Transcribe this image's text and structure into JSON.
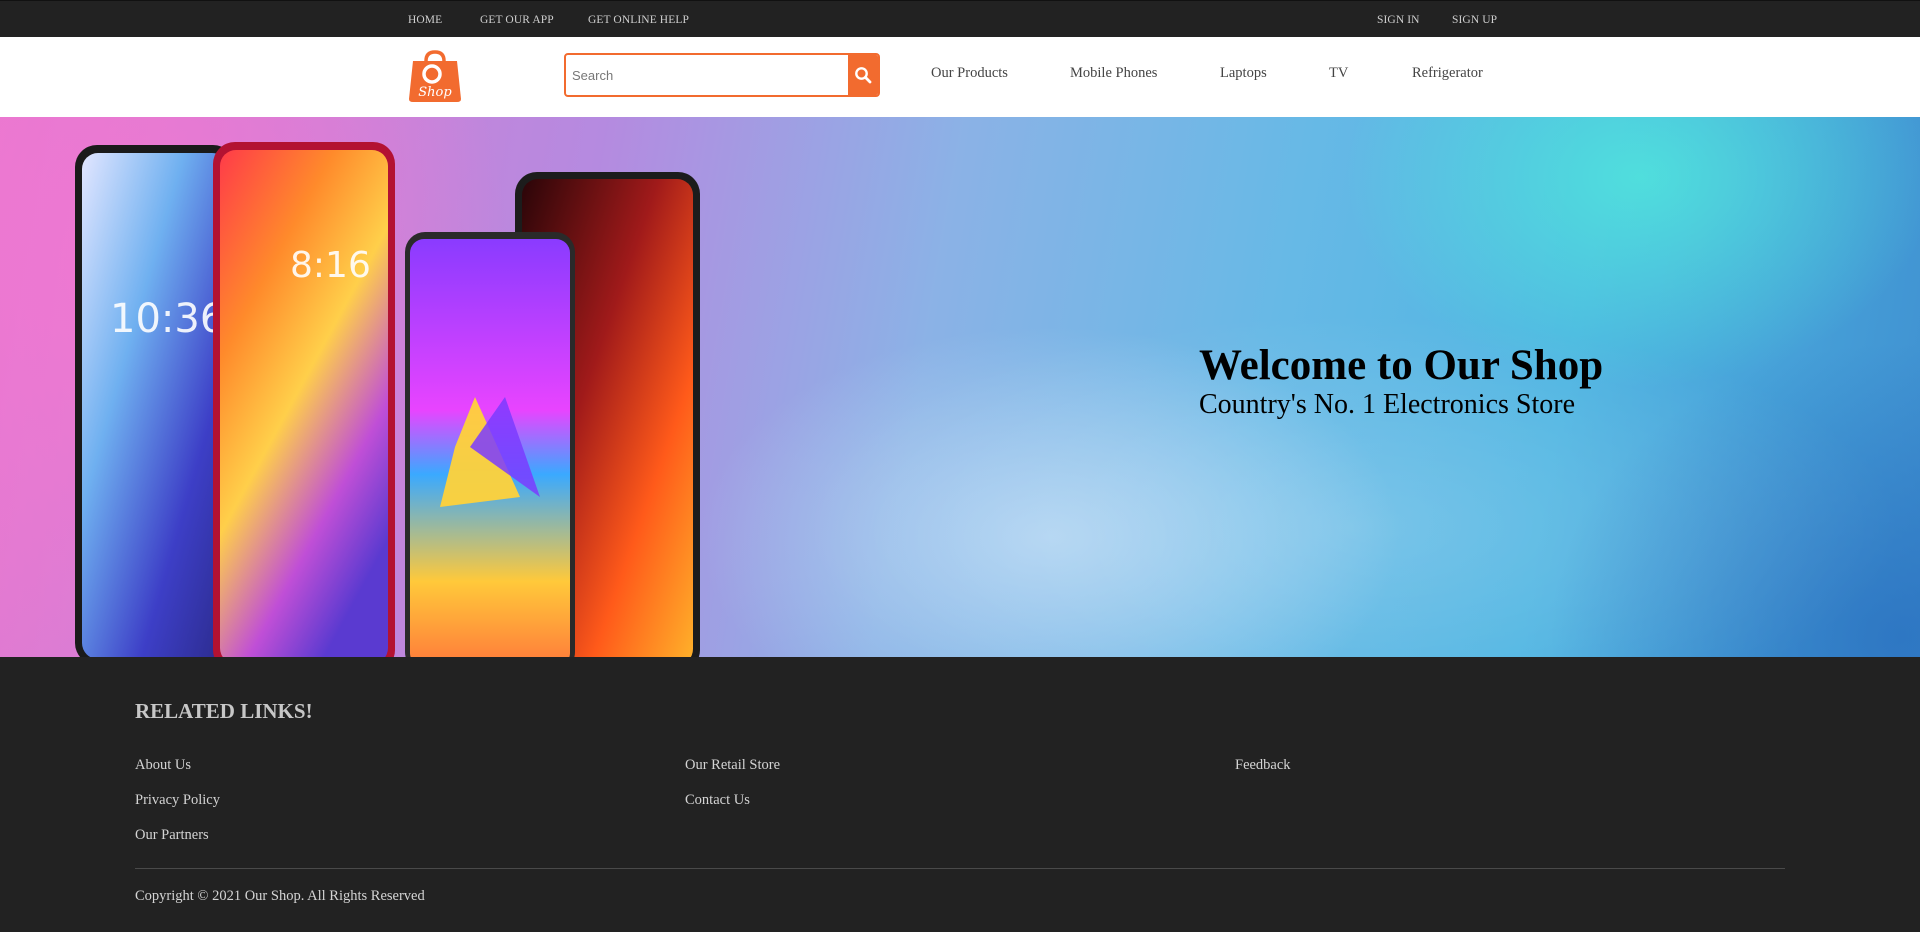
{
  "topbar": {
    "left_links": [
      "HOME",
      "GET OUR APP",
      "GET ONLINE HELP"
    ],
    "right_links": [
      "SIGN IN",
      "SIGN UP"
    ]
  },
  "header": {
    "logo_text": "Shop",
    "search_placeholder": "Search",
    "nav": [
      "Our Products",
      "Mobile Phones",
      "Laptops",
      "TV",
      "Refrigerator"
    ]
  },
  "hero": {
    "title": "Welcome to Our Shop",
    "subtitle": "Country's No. 1 Electronics Store"
  },
  "footer": {
    "title": "RELATED LINKS!",
    "columns": [
      [
        "About Us",
        "Privacy Policy",
        "Our Partners"
      ],
      [
        "Our Retail Store",
        "Contact Us"
      ],
      [
        "Feedback"
      ]
    ],
    "copyright": "Copyright © 2021 Our Shop. All Rights Reserved"
  },
  "colors": {
    "accent": "#f26b2f",
    "dark_bar": "#222222"
  },
  "icons": [
    "shopping-bag-logo-icon",
    "search-icon"
  ]
}
